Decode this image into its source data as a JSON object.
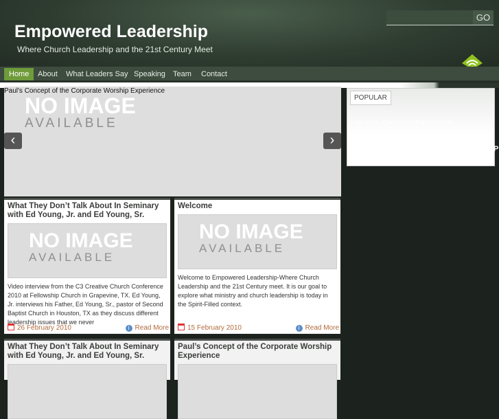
{
  "header": {
    "title": "Empowered Leadership",
    "tagline": "Where Church Leadership and the 21st Century Meet",
    "search_placeholder": "",
    "go": "GO"
  },
  "nav": [
    {
      "label": "Home"
    },
    {
      "label": "About"
    },
    {
      "label": "What Leaders Say"
    },
    {
      "label": "Speaking"
    },
    {
      "label": "Team"
    },
    {
      "label": "Contact"
    }
  ],
  "slider": {
    "title": "Paul's Concept of the Corporate Worship Experience"
  },
  "noimage": {
    "line1": "NO IMAGE",
    "line2": "AVAILABLE"
  },
  "sidebar": {
    "tab": "POPULAR",
    "error": "Fatal error: Call to undefined function",
    "stray": "P"
  },
  "posts": [
    {
      "title": "What They Don’t Talk About In Seminary with Ed Young, Jr. and Ed Young, Sr.",
      "excerpt": "Video interview from the C3 Creative Church Conference 2010 at Fellowship Church in Grapevine, TX. Ed Young, Jr. interviews his Father, Ed Young, Sr., pastor of Second Baptist Church in Houston, TX as they discuss different leadership issues that we never",
      "date": "26 February 2010",
      "more": "Read More"
    },
    {
      "title": "Welcome",
      "excerpt": "Welcome to Empowered Leadership-Where Church Leadership and the 21st Century meet. It is our goal to explore what ministry and church leadership is today in the Spirit-Filled context.",
      "date": "15 February 2010",
      "more": "Read More"
    },
    {
      "title": "What They Don’t Talk About In Seminary with Ed Young, Jr. and Ed Young, Sr."
    },
    {
      "title": "Paul’s Concept of the Corporate Worship Experience"
    }
  ]
}
